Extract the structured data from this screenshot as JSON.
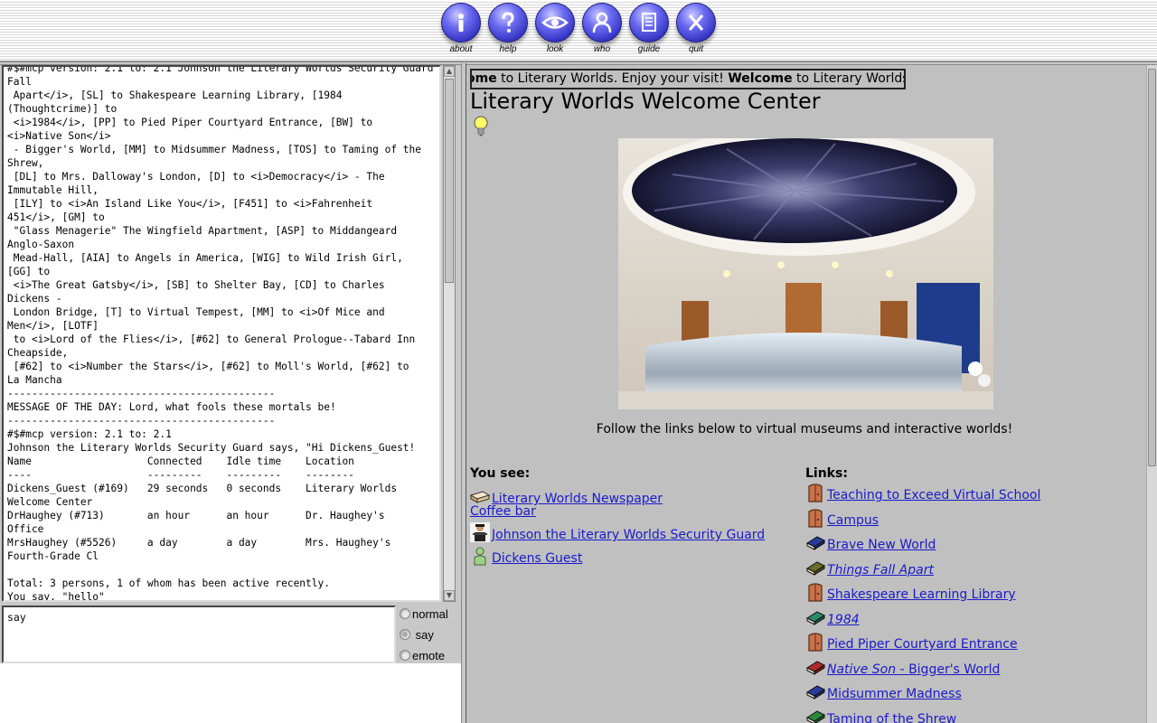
{
  "toolbar": {
    "buttons": [
      {
        "label": "about",
        "glyph": "i"
      },
      {
        "label": "help",
        "glyph": "?"
      },
      {
        "label": "look",
        "glyph": "eye"
      },
      {
        "label": "who",
        "glyph": "person"
      },
      {
        "label": "guide",
        "glyph": "page"
      },
      {
        "label": "quit",
        "glyph": "X"
      }
    ]
  },
  "log": {
    "text": "#$#mcp version: 2.1 to: 2.1 Johnson the Literary Worlds Security Guard says, \"Welcome to Things\nFall\n Apart</i>, [SL] to Shakespeare Learning Library, [1984\n(Thoughtcrime)] to\n <i>1984</i>, [PP] to Pied Piper Courtyard Entrance, [BW] to\n<i>Native Son</i>\n - Bigger's World, [MM] to Midsummer Madness, [TOS] to Taming of the\nShrew,\n [DL] to Mrs. Dalloway's London, [D] to <i>Democracy</i> - The\nImmutable Hill,\n [ILY] to <i>An Island Like You</i>, [F451] to <i>Fahrenheit\n451</i>, [GM] to\n \"Glass Menagerie\" The Wingfield Apartment, [ASP] to Middangeard\nAnglo-Saxon\n Mead-Hall, [AIA] to Angels in America, [WIG] to Wild Irish Girl,\n[GG] to\n <i>The Great Gatsby</i>, [SB] to Shelter Bay, [CD] to Charles\nDickens -\n London Bridge, [T] to Virtual Tempest, [MM] to <i>Of Mice and\nMen</i>, [LOTF]\n to <i>Lord of the Flies</i>, [#62] to General Prologue--Tabard Inn\nCheapside,\n [#62] to <i>Number the Stars</i>, [#62] to Moll's World, [#62] to\nLa Mancha\n--------------------------------------------\nMESSAGE OF THE DAY: Lord, what fools these mortals be!\n--------------------------------------------\n#$#mcp version: 2.1 to: 2.1\nJohnson the Literary Worlds Security Guard says, \"Hi Dickens_Guest!\nName                   Connected    Idle time    Location\n----                   ---------    ---------    --------\nDickens_Guest (#169)   29 seconds   0 seconds    Literary Worlds\nWelcome Center\nDrHaughey (#713)       an hour      an hour      Dr. Haughey's\nOffice\nMrsHaughey (#5526)     a day        a day        Mrs. Haughey's\nFourth-Grade Cl\n\nTotal: 3 persons, 1 of whom has been active recently.\nYou say, \"hello\""
  },
  "input": {
    "value": "say"
  },
  "modes": [
    {
      "label": "normal",
      "selected": false
    },
    {
      "label": "say",
      "selected": true
    },
    {
      "label": "emote",
      "selected": false
    }
  ],
  "marquee": {
    "parts": [
      {
        "text": "ome",
        "bold": true
      },
      {
        "text": " to Literary Worlds. Enjoy your visit! ",
        "bold": false
      },
      {
        "text": "Welcome",
        "bold": true
      },
      {
        "text": " to Literary Worlds. E",
        "bold": false
      }
    ]
  },
  "room": {
    "title": "Literary Worlds Welcome Center",
    "caption": "Follow the links below to virtual museums and interactive worlds!"
  },
  "you_see": {
    "heading": "You see:",
    "items": [
      {
        "label": "Literary Worlds Newspaper",
        "icon": "newspaper-icon"
      },
      {
        "label": "Coffee bar",
        "icon": ""
      },
      {
        "label": "Johnson the Literary Worlds Security Guard",
        "icon": "guard-icon"
      },
      {
        "label": "Dickens Guest",
        "icon": "guest-icon"
      }
    ]
  },
  "links": {
    "heading": "Links:",
    "items": [
      {
        "label": "Teaching to Exceed Virtual School",
        "icon": "door-icon",
        "italic": ""
      },
      {
        "label": "Campus",
        "icon": "door-icon",
        "italic": ""
      },
      {
        "label": "Brave New World",
        "icon": "book-icon",
        "italic": ""
      },
      {
        "label": "Things Fall Apart",
        "icon": "book-icon",
        "italic": "all"
      },
      {
        "label": "Shakespeare Learning Library",
        "icon": "door-icon",
        "italic": ""
      },
      {
        "label": "1984",
        "icon": "book-icon",
        "italic": "all"
      },
      {
        "label": "Pied Piper Courtyard Entrance",
        "icon": "door-icon",
        "italic": ""
      },
      {
        "label": "Bigger's World",
        "icon": "book-icon",
        "italic_prefix": "Native Son - "
      },
      {
        "label": "Midsummer Madness",
        "icon": "book-icon",
        "italic": ""
      },
      {
        "label": "Taming of the Shrew",
        "icon": "book-icon",
        "italic": ""
      }
    ]
  },
  "colors": {
    "link": "#1a1acc",
    "toolbar_button": "#4a4ae0",
    "pane_bg": "#c0c0c0"
  }
}
